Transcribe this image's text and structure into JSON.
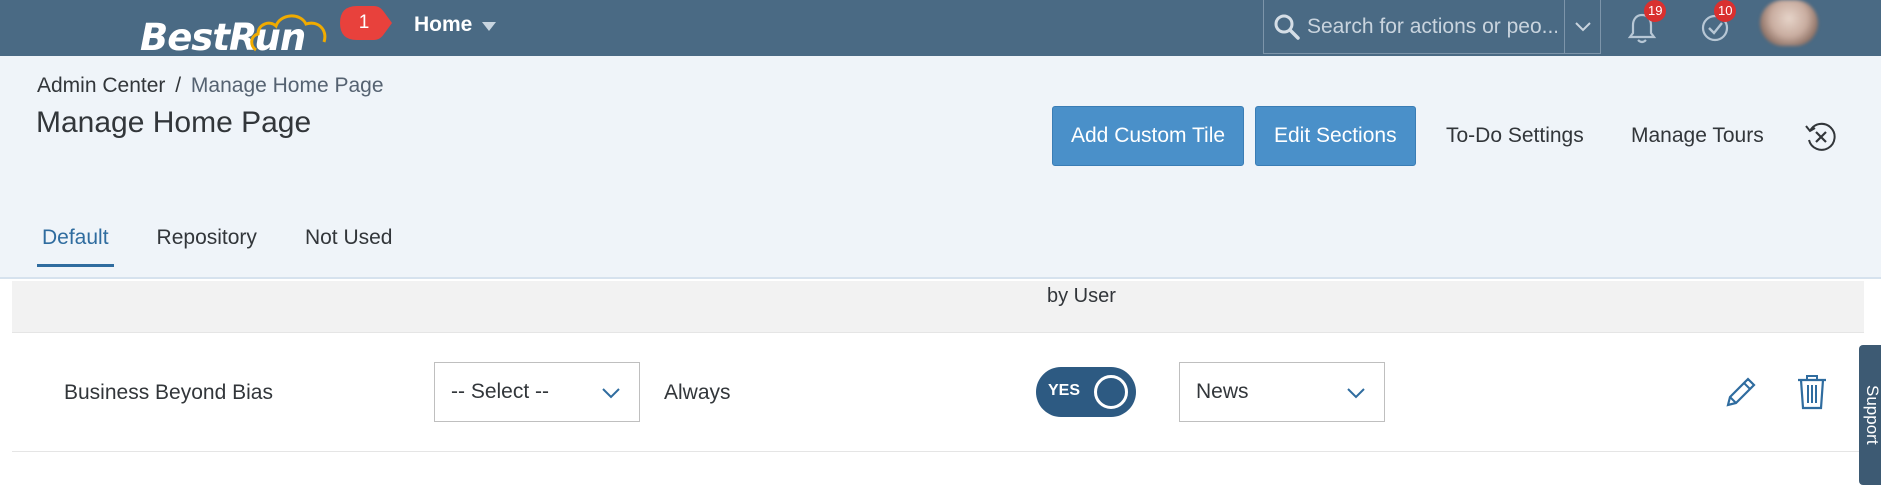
{
  "shell": {
    "logo_text": "BestRun",
    "step_badge": "1",
    "home_menu_label": "Home",
    "search_placeholder": "Search for actions or peo...",
    "notifications_count": "19",
    "todo_count": "10"
  },
  "breadcrumb": {
    "parent": "Admin Center",
    "separator": "/",
    "current": "Manage Home Page"
  },
  "page": {
    "title": "Manage Home Page"
  },
  "actions": {
    "add_custom_tile": "Add Custom Tile",
    "edit_sections": "Edit Sections",
    "todo_settings": "To-Do Settings",
    "manage_tours": "Manage Tours"
  },
  "tabs": [
    {
      "label": "Default",
      "active": true
    },
    {
      "label": "Repository",
      "active": false
    },
    {
      "label": "Not Used",
      "active": false
    }
  ],
  "table": {
    "header_fragment": "by User",
    "rows": [
      {
        "name": "Business Beyond Bias",
        "select_value": "-- Select --",
        "visibility": "Always",
        "toggle": "YES",
        "section": "News"
      }
    ]
  },
  "support_label": "Support",
  "colors": {
    "shell": "#4a6a84",
    "header_bg": "#eff4f9",
    "primary_button": "#4a90c9",
    "tab_active": "#2f6c9f",
    "toggle_on": "#2d5a82",
    "badge": "#d9302f"
  },
  "icons": [
    "search-icon",
    "chevron-down-icon",
    "bell-icon",
    "checkmark-circle-icon",
    "restore-close-icon",
    "pencil-icon",
    "trash-icon",
    "cursor-arrow-icon",
    "cloud-icon"
  ]
}
